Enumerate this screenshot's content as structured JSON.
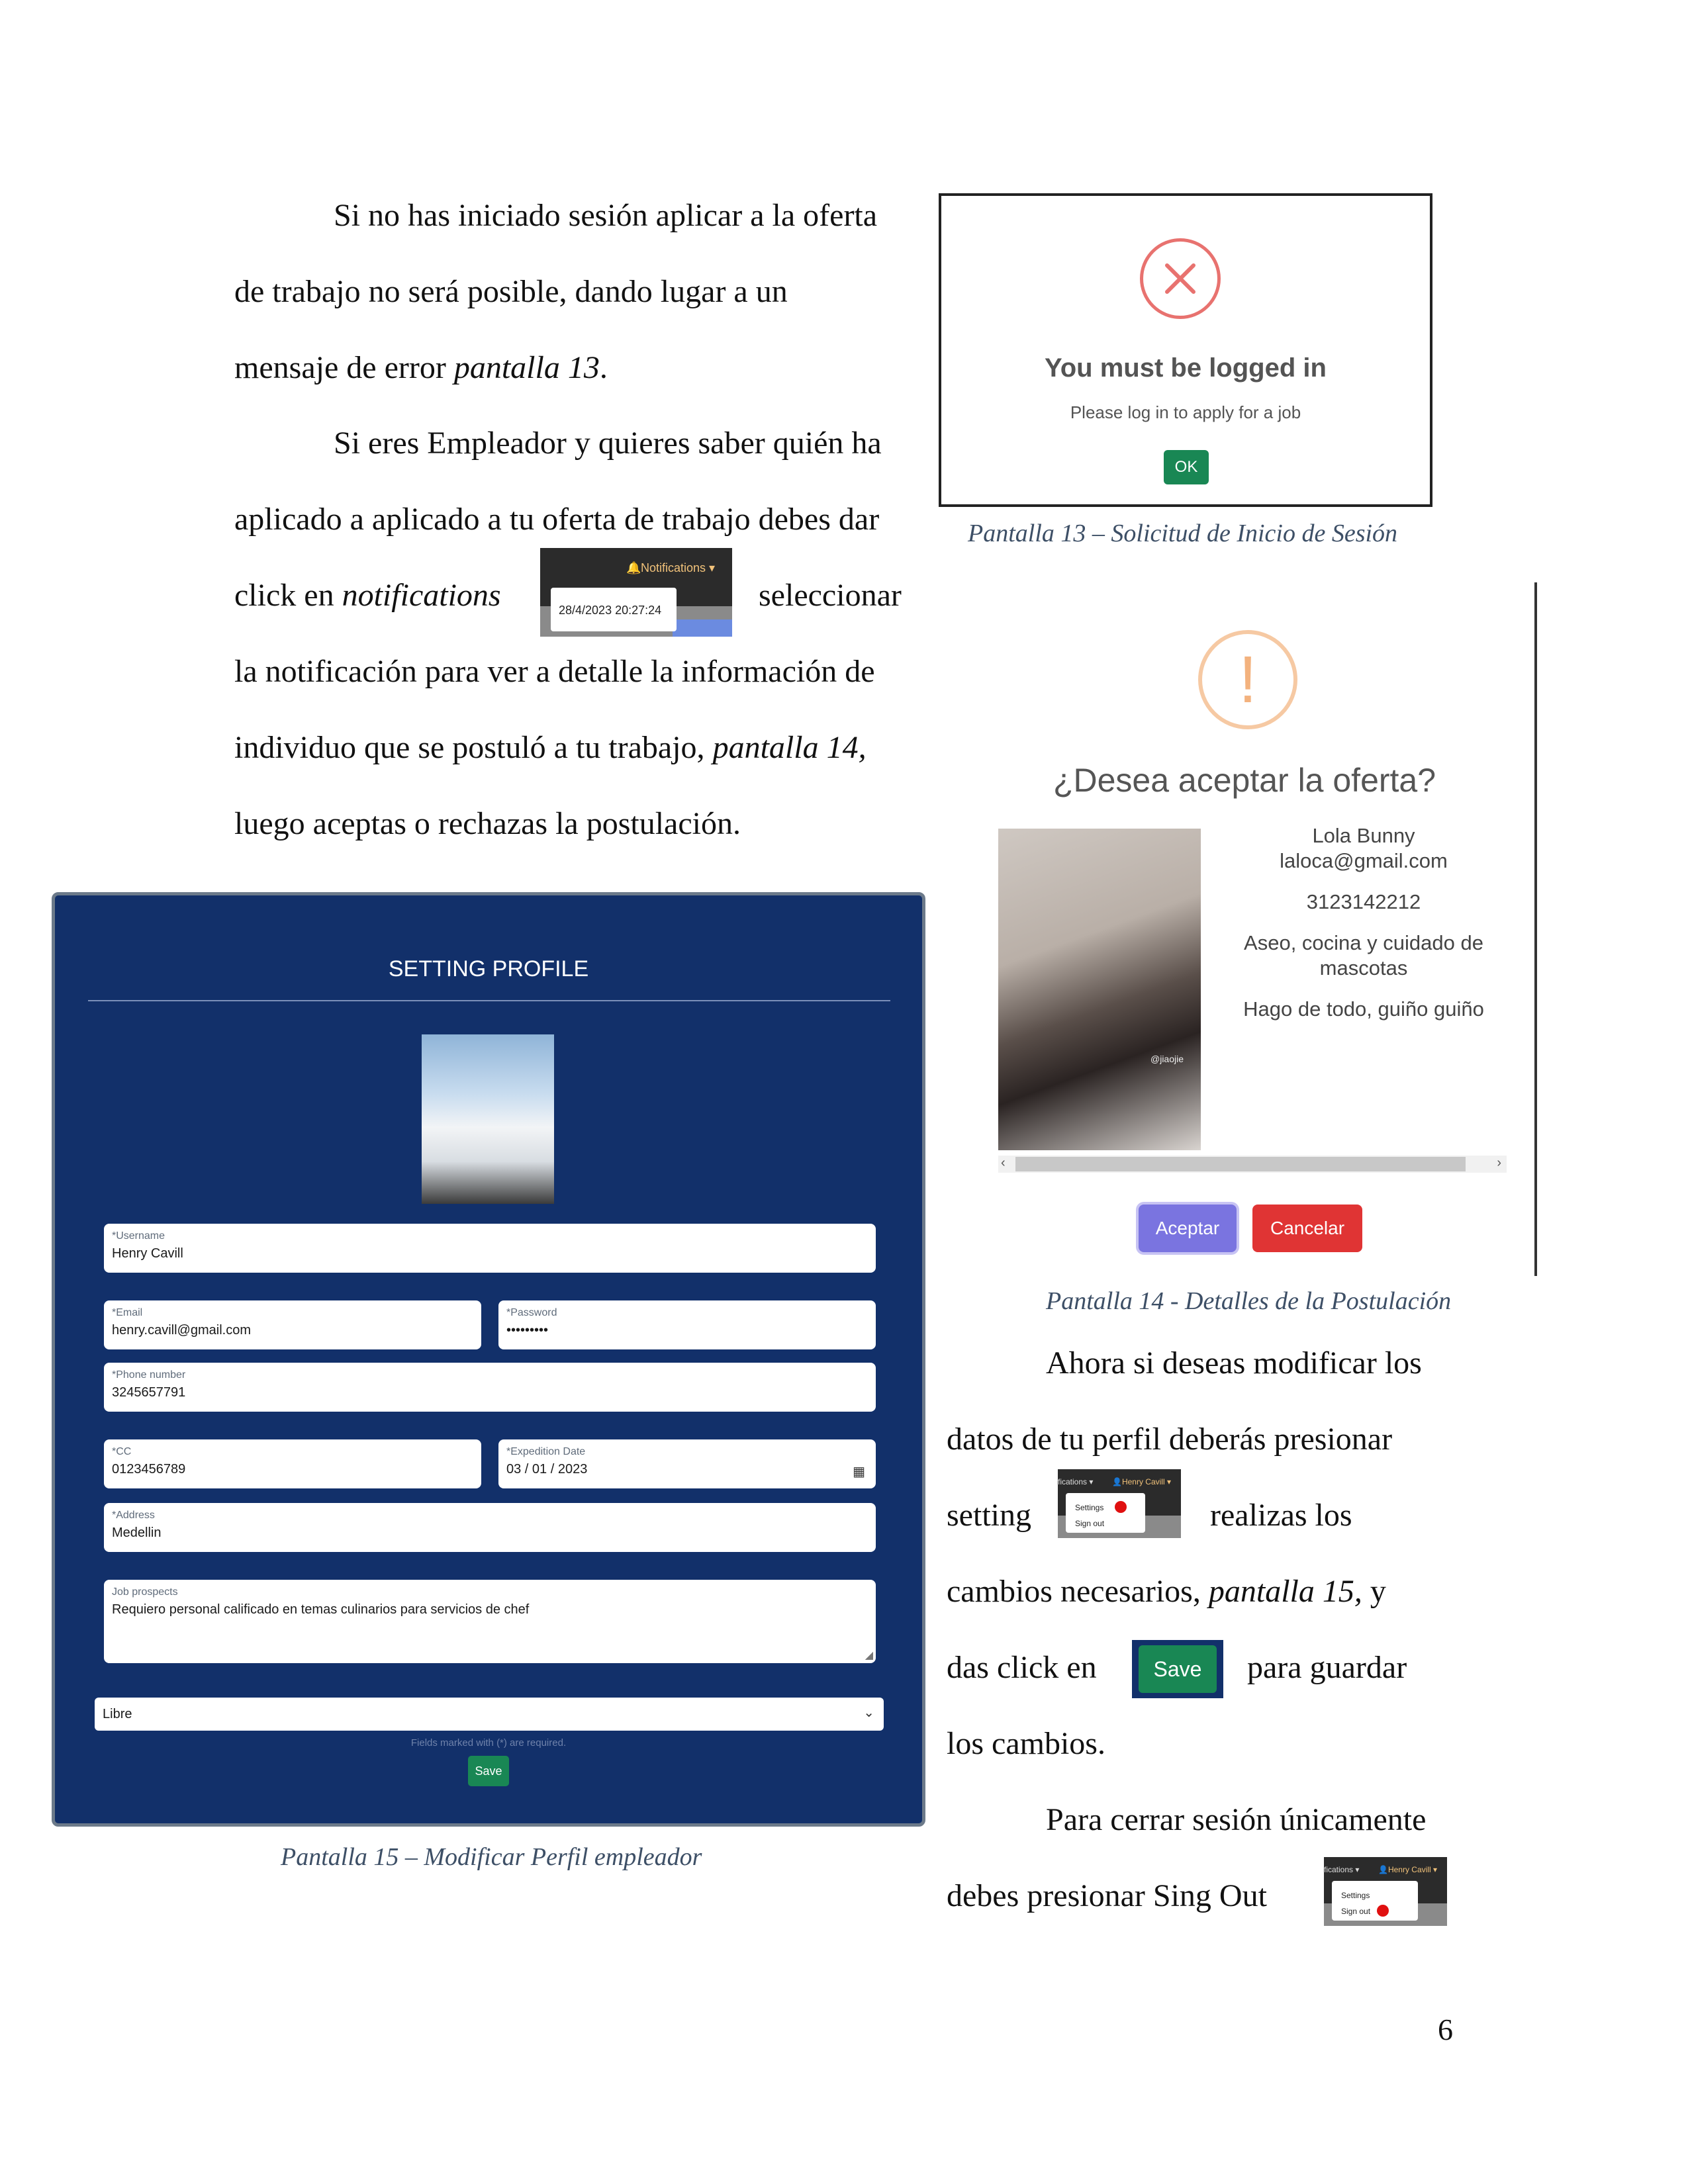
{
  "text": {
    "p1_l1": "Si no has iniciado sesión aplicar a la oferta",
    "p1_l2": "de trabajo no será posible, dando lugar a un",
    "p1_l3a": "mensaje de error ",
    "p1_l3b": "pantalla 13",
    "p1_l3c": ".",
    "p2_l1": "Si eres Empleador y quieres saber quién ha",
    "p2_l2": "aplicado a aplicado a tu oferta de trabajo debes dar",
    "p2_l3a": "click en ",
    "p2_l3b": "notifications",
    "p2_l3c": "seleccionar",
    "p2_l4": "la notificación para ver a detalle la información de",
    "p2_l5a": "individuo que se postuló a tu trabajo, ",
    "p2_l5b": "pantalla 14,",
    "p2_l6": "luego aceptas o rechazas la postulación.",
    "p3_l1": "Ahora si deseas modificar los",
    "p3_l2": "datos de tu perfil deberás presionar",
    "p3_l3a": "setting",
    "p3_l3b": "realizas los",
    "p3_l4a": "cambios necesarios, ",
    "p3_l4b": "pantalla 15,",
    "p3_l4c": " y",
    "p3_l5a": "das click en",
    "p3_l5b": "para guardar",
    "p3_l6": "los cambios.",
    "p4_l1": "Para cerrar sesión únicamente",
    "p4_l2": "debes presionar Sing Out",
    "page_number": "6"
  },
  "captions": {
    "c13": "Pantalla 13 – Solicitud de Inicio de Sesión",
    "c14": "Pantalla 14 -  Detalles de la Postulación",
    "c15": "Pantalla 15 – Modificar Perfil empleador"
  },
  "notif_inline": {
    "menu": "Notifications",
    "date": "28/4/2023 20:27:24"
  },
  "login_dialog": {
    "title": "You must be logged in",
    "message": "Please log in to apply for a job",
    "ok_label": "OK",
    "error_color": "#e8726f"
  },
  "offer_dialog": {
    "title": "¿Desea aceptar la oferta?",
    "name": "Lola Bunny",
    "email": "laloca@gmail.com",
    "phone": "3123142212",
    "skills": "Aseo, cocina y cuidado de mascotas",
    "description": "Hago de todo, guiño guiño",
    "accept_label": "Aceptar",
    "cancel_label": "Cancelar",
    "watermark": "@jiaojie",
    "accept_color": "#7a74e0",
    "cancel_color": "#e03434"
  },
  "settings_form": {
    "title": "SETTING PROFILE",
    "username_label": "*Username",
    "username": "Henry Cavill",
    "email_label": "*Email",
    "email": "henry.cavill@gmail.com",
    "password_label": "*Password",
    "password": "•••••••••",
    "phone_label": "*Phone number",
    "phone": "3245657791",
    "cc_label": "*CC",
    "cc": "0123456789",
    "exp_label": "*Expedition Date",
    "exp": "03 / 01 / 2023",
    "address_label": "*Address",
    "address": "Medellin",
    "job_label": "Job prospects",
    "job": "Requiero personal calificado en temas culinarios para servicios de chef",
    "status": "Libre",
    "required_note": "Fields marked with (*) are required.",
    "save_label": "Save",
    "bg_color": "#12306a"
  },
  "nav_crops": {
    "menu_fragment": "fications",
    "user": "Henry Cavill",
    "settings": "Settings",
    "signout": "Sign out"
  },
  "save_inline": "Save"
}
